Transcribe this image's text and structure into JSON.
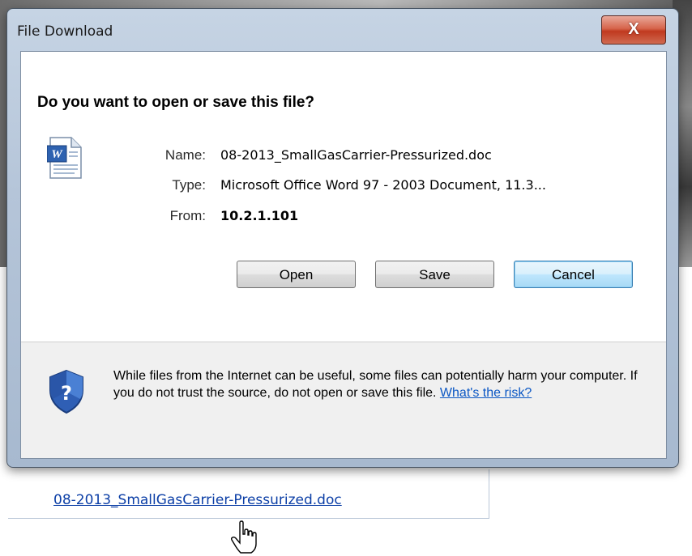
{
  "dialog": {
    "title": "File Download",
    "close_label": "X",
    "question": "Do you want to open or save this file?",
    "file_icon": "word-document-icon",
    "fields": {
      "name_label": "Name:",
      "name_value": "08-2013_SmallGasCarrier-Pressurized.doc",
      "type_label": "Type:",
      "type_value": "Microsoft Office Word 97 - 2003 Document, 11.3...",
      "from_label": "From:",
      "from_value": "10.2.1.101"
    },
    "buttons": {
      "open": "Open",
      "save": "Save",
      "cancel": "Cancel"
    },
    "warning_icon": "security-shield-question-icon",
    "warning_text": "While files from the Internet can be useful, some files can potentially harm your computer. If you do not trust the source, do not open or save this file.",
    "risk_link": "What's the risk?"
  },
  "page": {
    "link_text": "08-2013_SmallGasCarrier-Pressurized.doc",
    "cursor_icon": "hand-pointer-icon"
  },
  "colors": {
    "link": "#0b3ea6",
    "close_button": "#c0391f",
    "default_button_border": "#3c7fb1"
  }
}
